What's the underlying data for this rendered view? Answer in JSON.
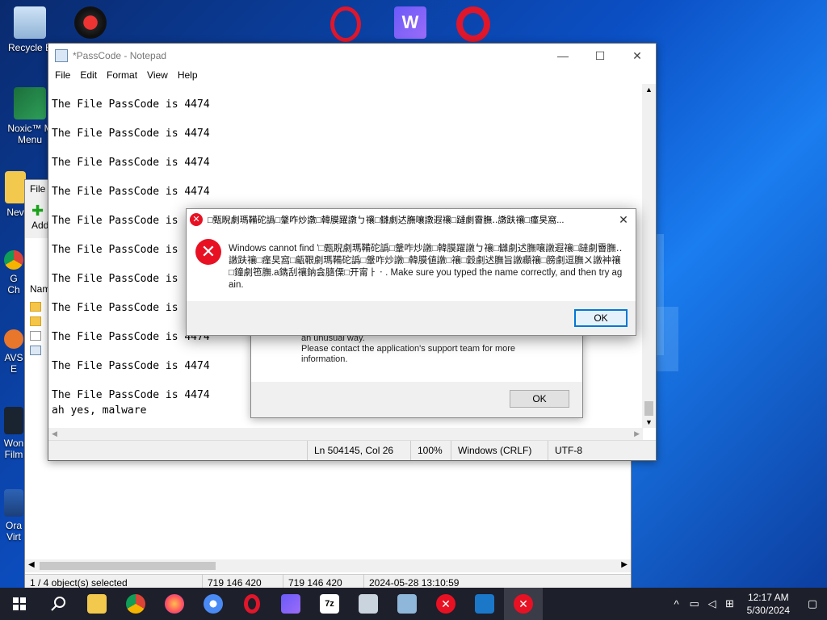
{
  "desktop": {
    "icons": [
      {
        "label": "Recycle B"
      },
      {
        "label": "Noxic™ M\nMenu"
      },
      {
        "label": "Nev"
      },
      {
        "label": "G\nCh"
      },
      {
        "label": "AVS\nE"
      },
      {
        "label": "Won\nFilm"
      },
      {
        "label": "Ora\nVirt"
      }
    ]
  },
  "explorer": {
    "menu_item": "File",
    "toolbar_item": "Add",
    "column_header": "Nam",
    "status": {
      "selected": "1 / 4 object(s) selected",
      "size1": "719 146 420",
      "size2": "719 146 420",
      "date": "2024-05-28 13:10:59"
    }
  },
  "notepad": {
    "title": "*PassCode - Notepad",
    "menu": [
      "File",
      "Edit",
      "Format",
      "View",
      "Help"
    ],
    "lines": [
      "The File PassCode is 4474",
      "The File PassCode is 4474",
      "The File PassCode is 4474",
      "The File PassCode is 4474",
      "The File PassCode is",
      "The File PassCode is",
      "The File PassCode is",
      "The File PassCode is",
      "The File PassCode is 4474",
      "The File PassCode is 4474",
      "The File PassCode is 4474"
    ],
    "last_line": "ah yes, malware",
    "status": {
      "position": "Ln 504145, Col 26",
      "zoom": "100%",
      "eol": "Windows (CRLF)",
      "encoding": "UTF-8"
    }
  },
  "dialog_back": {
    "message": "an unusual way.\nPlease contact the application's support team for more information.",
    "ok_label": "OK"
  },
  "dialog": {
    "title": "□甄睨劇瑪鞴砣譌□鞶咋炒譈□韓膜躍譈ㄅ禳□讎劇迖膴嚷譈遐禳□躂劇霫膴‥譈趺禳□瘽旲窩...",
    "message": "Windows cannot find '□甄睨劇瑪鞴砣譌□鞶咋炒譈□韓膜躍譈ㄅ禳□讎劇迖膴嚷譈遐禳□躂劇霫膴‥譈趺禳□瘽旲窩□甂鞎劇瑪鞴砣譌□鞶咋炒譈□韓膜値譈□禳□穀劇迖膴旨譈顣禳□膀劇逗膴ㄨ譈衶禳□鐘劇竾膴.a鐫刮禳鈉侌膸傈□开甯ㅏㆍ. Make sure you typed the name correctly, and then try again.",
    "ok_label": "OK"
  },
  "taskbar": {
    "time": "12:17 AM",
    "date": "5/30/2024",
    "apps": [
      "file-explorer",
      "chrome",
      "firefox",
      "chromium",
      "opera",
      "wondershare",
      "7zip",
      "app-1",
      "app-2",
      "error-app-1",
      "app-3",
      "error-app-2"
    ]
  }
}
